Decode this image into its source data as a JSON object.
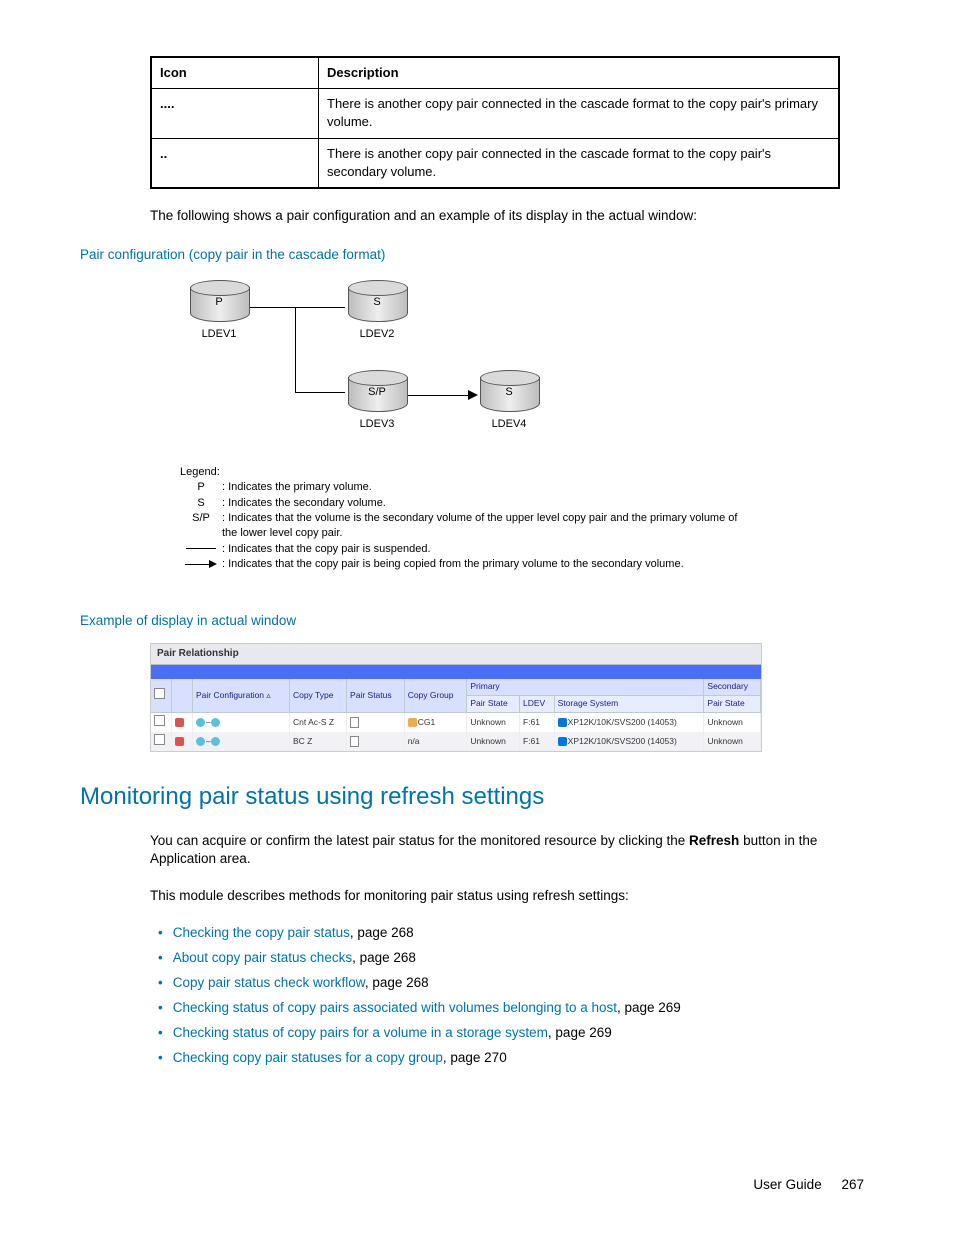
{
  "iconTable": {
    "headers": [
      "Icon",
      "Description"
    ],
    "rows": [
      {
        "icon": "....",
        "desc": "There is another copy pair connected in the cascade format to the copy pair's primary volume."
      },
      {
        "icon": "..",
        "desc": "There is another copy pair connected in the cascade format to the copy pair's secondary volume."
      }
    ]
  },
  "introText": "The following shows a pair configuration and an example of its display in the actual window:",
  "caption1": "Pair configuration (copy pair in the cascade format)",
  "diagram": {
    "nodes": {
      "ldev1": {
        "role": "P",
        "label": "LDEV1"
      },
      "ldev2": {
        "role": "S",
        "label": "LDEV2"
      },
      "ldev3": {
        "role": "S/P",
        "label": "LDEV3"
      },
      "ldev4": {
        "role": "S",
        "label": "LDEV4"
      }
    },
    "legendTitle": "Legend:",
    "legend": [
      {
        "key": "P",
        "text": ": Indicates the primary volume."
      },
      {
        "key": "S",
        "text": ": Indicates the secondary volume."
      },
      {
        "key": "S/P",
        "text": ": Indicates that the volume is the secondary volume of the upper level copy pair and the primary volume of the lower level copy pair."
      },
      {
        "key": "—",
        "text": ": Indicates that the copy pair is suspended."
      },
      {
        "key": "→",
        "text": ": Indicates that the copy pair is being copied from the primary volume to the secondary volume."
      }
    ]
  },
  "caption2": "Example of display in actual window",
  "pairRel": {
    "title": "Pair Relationship",
    "groupHeaders": {
      "primary": "Primary",
      "secondary": "Secondary"
    },
    "columns": [
      "",
      "",
      "Pair Configuration",
      "Copy Type",
      "Pair Status",
      "Copy Group",
      "Pair State",
      "LDEV",
      "Storage System",
      "Pair State"
    ],
    "rows": [
      {
        "copyType": "Cnt Ac-S Z",
        "copyGroup": "CG1",
        "pairState": "Unknown",
        "ldev": "F:61",
        "storage": "XP12K/10K/SVS200 (14053)",
        "secState": "Unknown"
      },
      {
        "copyType": "BC Z",
        "copyGroup": "n/a",
        "pairState": "Unknown",
        "ldev": "F:61",
        "storage": "XP12K/10K/SVS200 (14053)",
        "secState": "Unknown"
      }
    ]
  },
  "section": {
    "heading": "Monitoring pair status using refresh settings",
    "para1a": "You can acquire or confirm the latest pair status for the monitored resource by clicking the ",
    "para1bold": "Refresh",
    "para1b": " button in the Application area.",
    "para2": "This module describes methods for monitoring pair status using refresh settings:",
    "links": [
      {
        "text": "Checking the copy pair status",
        "page": ", page 268"
      },
      {
        "text": "About copy pair status checks",
        "page": ", page 268"
      },
      {
        "text": "Copy pair status check workflow",
        "page": ", page 268"
      },
      {
        "text": "Checking status of copy pairs associated with volumes belonging to a host",
        "page": ", page 269"
      },
      {
        "text": "Checking status of copy pairs for a volume in a storage system",
        "page": ", page 269"
      },
      {
        "text": "Checking copy pair statuses for a copy group",
        "page": ", page 270"
      }
    ]
  },
  "footer": {
    "title": "User Guide",
    "page": "267"
  }
}
